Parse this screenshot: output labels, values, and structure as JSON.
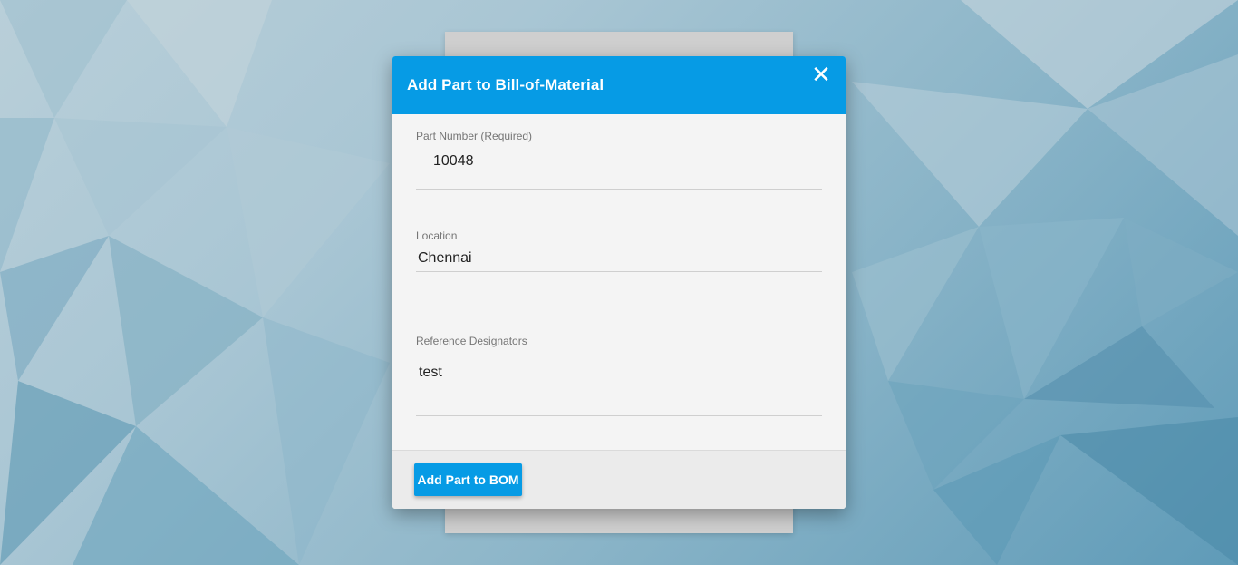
{
  "dialog": {
    "title": "Add Part to Bill-of-Material",
    "close_icon": "close-icon",
    "close_glyph": "✕",
    "accent_color": "#069be5"
  },
  "fields": {
    "part_number": {
      "label": "Part Number (Required)",
      "value": "10048"
    },
    "location": {
      "label": "Location",
      "value": "Chennai"
    },
    "reference_designators": {
      "label": "Reference Designators",
      "value": "test"
    }
  },
  "footer": {
    "submit_label": "Add Part to BOM"
  }
}
